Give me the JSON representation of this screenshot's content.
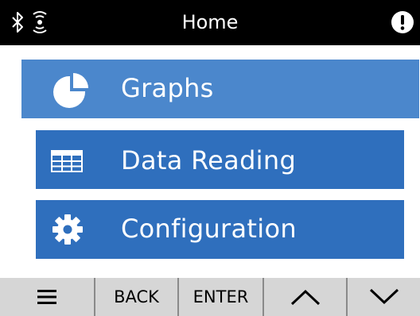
{
  "status_bar": {
    "title": "Home",
    "icons": [
      "bluetooth-icon",
      "wireless-icon",
      "alert-icon"
    ]
  },
  "menu": {
    "items": [
      {
        "label": "Graphs",
        "icon": "pie-chart-icon",
        "selected": true
      },
      {
        "label": "Data Reading",
        "icon": "table-icon",
        "selected": false
      },
      {
        "label": "Configuration",
        "icon": "gear-icon",
        "selected": false
      }
    ]
  },
  "softkeys": {
    "menu_icon": "hamburger-menu-icon",
    "back": "BACK",
    "enter": "ENTER",
    "up_icon": "chevron-up-icon",
    "down_icon": "chevron-down-icon"
  },
  "colors": {
    "status_bar_bg": "#000000",
    "selected_item": "#4b87cc",
    "item": "#2f6fbd",
    "softkey_bar": "#d6d6d6"
  }
}
